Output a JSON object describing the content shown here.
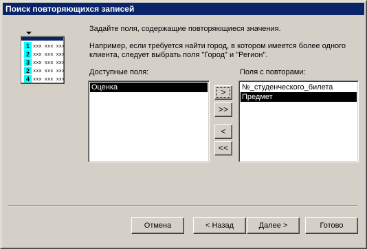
{
  "window": {
    "title": "Поиск повторяющихся записей"
  },
  "intro": {
    "line1": "Задайте поля, содержащие повторяющиеся значения.",
    "line2": "Например, если требуется найти город, в котором имеется более одного",
    "line3": "клиента, следует выбрать поля \"Город\" и \"Регион\"."
  },
  "available": {
    "label": "Доступные поля:",
    "items": [
      "Оценка"
    ]
  },
  "selected": {
    "label": "Поля с повторами:",
    "items": [
      "№_студенческого_билета",
      "Предмет"
    ]
  },
  "move_buttons": {
    "add_one": ">",
    "add_all": ">>",
    "remove_one": "<",
    "remove_all": "<<"
  },
  "illustration": {
    "numbers": [
      "1",
      "2",
      "3",
      "2",
      "4"
    ],
    "cells": "xxx xxx xxx"
  },
  "buttons": {
    "cancel": "Отмена",
    "back": "< Назад",
    "next": "Далее >",
    "finish": "Готово"
  },
  "colors": {
    "titlebar": "#0a246a",
    "face": "#d4d0c8",
    "illus_rows": "#00ffff"
  }
}
